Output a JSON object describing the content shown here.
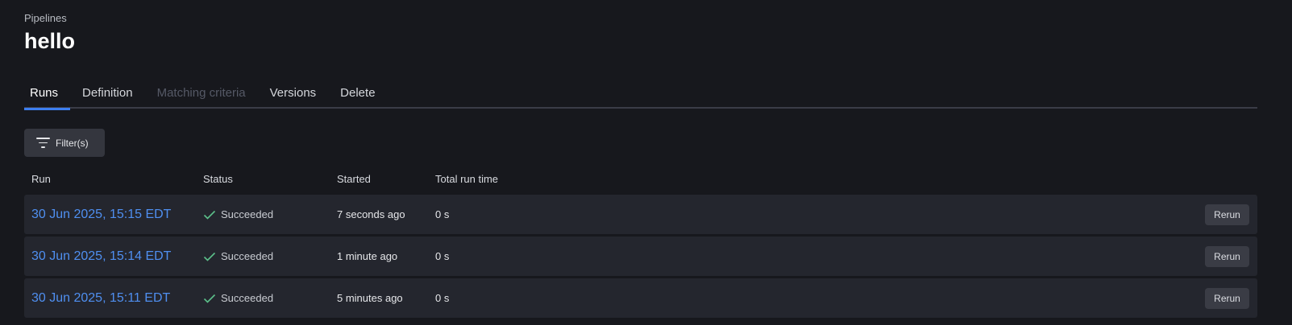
{
  "header": {
    "breadcrumb": "Pipelines",
    "title": "hello"
  },
  "tabs": [
    {
      "label": "Runs",
      "state": "active"
    },
    {
      "label": "Definition",
      "state": "normal"
    },
    {
      "label": "Matching criteria",
      "state": "disabled"
    },
    {
      "label": "Versions",
      "state": "normal"
    },
    {
      "label": "Delete",
      "state": "normal"
    }
  ],
  "filter": {
    "label": "Filter(s)",
    "icon": "filter-icon"
  },
  "table": {
    "columns": [
      "Run",
      "Status",
      "Started",
      "Total run time"
    ],
    "rows": [
      {
        "run": "30 Jun 2025, 15:15 EDT",
        "status": "Succeeded",
        "started": "7 seconds ago",
        "runtime": "0 s",
        "action": "Rerun"
      },
      {
        "run": "30 Jun 2025, 15:14 EDT",
        "status": "Succeeded",
        "started": "1 minute ago",
        "runtime": "0 s",
        "action": "Rerun"
      },
      {
        "run": "30 Jun 2025, 15:11 EDT",
        "status": "Succeeded",
        "started": "5 minutes ago",
        "runtime": "0 s",
        "action": "Rerun"
      }
    ]
  },
  "colors": {
    "accent": "#3d7ef0",
    "link": "#4f8ff0",
    "success": "#5cc08a",
    "background": "#17181d"
  }
}
